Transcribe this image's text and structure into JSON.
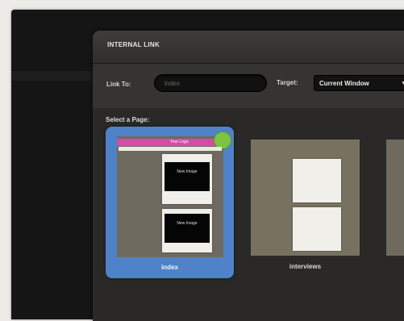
{
  "dialog": {
    "title": "INTERNAL LINK",
    "link_to_label": "Link To:",
    "link_to_value": "index",
    "target_label": "Target:",
    "target_value": "Current Window",
    "select_page_label": "Select a Page:"
  },
  "pages": [
    {
      "name": "index",
      "selected": true,
      "header_text": "Your Logo",
      "image_text": "New Image"
    },
    {
      "name": "interviews",
      "selected": false
    }
  ],
  "colors": {
    "selected_bg": "#4f82c8",
    "banner": "#d64ba4",
    "logo_badge": "#7cc243"
  }
}
